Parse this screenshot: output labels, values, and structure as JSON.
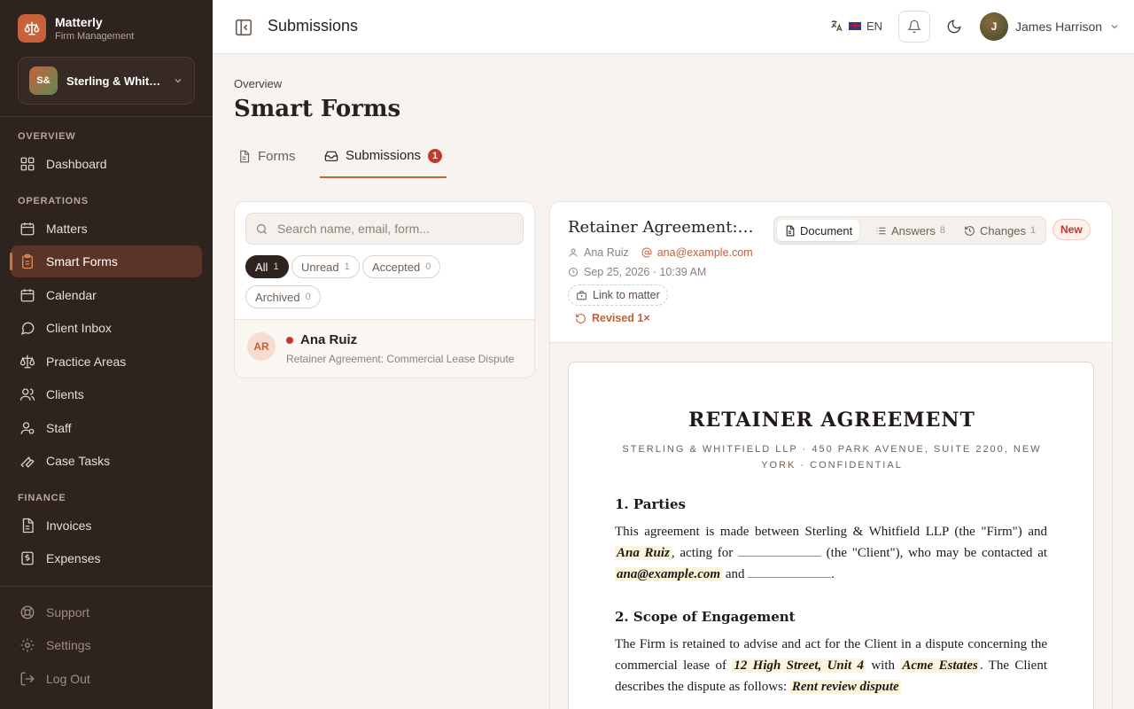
{
  "app": {
    "name": "Matterly",
    "subtitle": "Firm Management",
    "firm_initials": "S&",
    "firm_name": "Sterling & Whitfield LLP"
  },
  "sidebar": {
    "sections": [
      {
        "label": "OVERVIEW",
        "items": [
          {
            "label": "Dashboard",
            "icon": "dashboard-icon"
          }
        ]
      },
      {
        "label": "OPERATIONS",
        "items": [
          {
            "label": "Matters",
            "icon": "briefcase-icon"
          },
          {
            "label": "Smart Forms",
            "icon": "clipboard-icon",
            "active": true
          },
          {
            "label": "Calendar",
            "icon": "calendar-icon"
          },
          {
            "label": "Client Inbox",
            "icon": "chat-icon"
          },
          {
            "label": "Practice Areas",
            "icon": "scale-icon"
          },
          {
            "label": "Clients",
            "icon": "users-icon"
          },
          {
            "label": "Staff",
            "icon": "staff-icon"
          },
          {
            "label": "Case Tasks",
            "icon": "wrench-icon"
          }
        ]
      },
      {
        "label": "FINANCE",
        "items": [
          {
            "label": "Invoices",
            "icon": "invoice-icon"
          },
          {
            "label": "Expenses",
            "icon": "expense-icon"
          }
        ]
      }
    ],
    "footer": [
      {
        "label": "Support",
        "icon": "lifebuoy-icon"
      },
      {
        "label": "Settings",
        "icon": "gear-icon"
      },
      {
        "label": "Log Out",
        "icon": "logout-icon"
      }
    ]
  },
  "topbar": {
    "title": "Submissions",
    "language": "EN",
    "user_initial": "J",
    "user_name": "James Harrison"
  },
  "page": {
    "breadcrumb": "Overview",
    "title": "Smart Forms",
    "tabs": [
      {
        "label": "Forms",
        "icon": "document-icon"
      },
      {
        "label": "Submissions",
        "icon": "inbox-icon",
        "badge": "1",
        "active": true
      }
    ]
  },
  "list": {
    "search_placeholder": "Search name, email, form...",
    "filters": [
      {
        "label": "All",
        "count": "1",
        "active": true
      },
      {
        "label": "Unread",
        "count": "1"
      },
      {
        "label": "Accepted",
        "count": "0"
      },
      {
        "label": "Archived",
        "count": "0"
      }
    ],
    "items": [
      {
        "initials": "AR",
        "name": "Ana Ruiz",
        "form": "Retainer Agreement: Commercial Lease Dispute",
        "unread": true
      }
    ]
  },
  "detail": {
    "title": "Retainer Agreement: Commercial Lease Dispute",
    "client_name": "Ana Ruiz",
    "client_email": "ana@example.com",
    "submitted_at": "Sep 25, 2026 · 10:39 AM",
    "link_label": "Link to matter",
    "revised_label": "Revised 1×",
    "status_badge": "New",
    "view_tabs": [
      {
        "label": "Document",
        "icon": "document-icon",
        "count": "",
        "active": true
      },
      {
        "label": "Answers",
        "icon": "list-icon",
        "count": "8"
      },
      {
        "label": "Changes",
        "icon": "history-icon",
        "count": "1"
      }
    ],
    "document": {
      "title": "RETAINER AGREEMENT",
      "subtitle": "STERLING & WHITFIELD LLP · 450 PARK AVENUE, SUITE 2200, NEW YORK · CONFIDENTIAL",
      "s1_heading": "1. Parties",
      "s1_text_a": "This agreement is made between Sterling & Whitfield LLP (the \"Firm\") and",
      "s1_fill_name": "Ana Ruiz",
      "s1_text_b": ", acting for",
      "s1_text_c": "(the \"Client\"), who may be contacted at",
      "s1_fill_email": "ana@example.com",
      "s1_text_d": "and",
      "s1_text_e": ".",
      "s2_heading": "2. Scope of Engagement",
      "s2_text_a": "The Firm is retained to advise and act for the Client in a dispute concerning the commercial lease of",
      "s2_fill_property": "12 High Street, Unit 4",
      "s2_text_b": "with",
      "s2_fill_landlord": "Acme Estates",
      "s2_text_c": ". The Client describes the dispute as follows:",
      "s2_fill_dispute": "Rent review dispute"
    }
  },
  "colors": {
    "accent": "#c8623a",
    "sidebar_bg": "#2e231e",
    "badge": "#c0392b"
  }
}
